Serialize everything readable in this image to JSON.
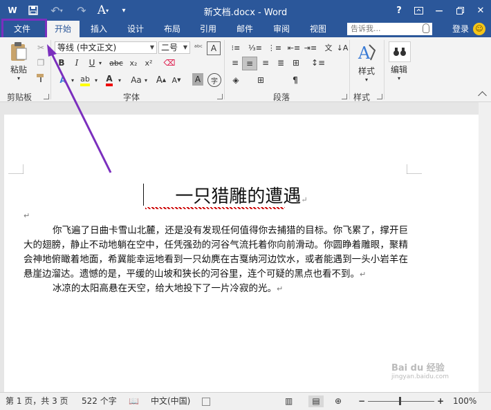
{
  "titlebar": {
    "title": "新文档.docx - Word",
    "help": "?",
    "ribbon_display": "⧉",
    "minimize": "—",
    "restore": "❐",
    "close": "✕"
  },
  "quick_access": {
    "word_icon": "W",
    "save": "💾",
    "undo": "↶",
    "redo": "↷",
    "format": "A",
    "customize": "▾"
  },
  "tabs": [
    "文件",
    "开始",
    "插入",
    "设计",
    "布局",
    "引用",
    "邮件",
    "审阅",
    "视图"
  ],
  "active_tab": "开始",
  "tell_me": {
    "placeholder": "告诉我..."
  },
  "signin": "登录",
  "ribbon": {
    "clipboard": {
      "paste": "粘贴",
      "label": "剪贴板"
    },
    "font": {
      "font_name": "等线 (中文正文)",
      "font_size": "二号",
      "label": "字体",
      "bold": "B",
      "italic": "I",
      "underline": "U",
      "strike": "abc",
      "subscript": "x₂",
      "superscript": "x²",
      "grow": "A",
      "shrink": "A",
      "char_shading": "A",
      "phonetic": "文",
      "encircle": "字",
      "aa": "Aa",
      "clear": "A",
      "font_color": "A",
      "highlight": "ab"
    },
    "paragraph": {
      "label": "段落"
    },
    "styles": {
      "button": "样式",
      "label": "样式"
    },
    "editing": {
      "button": "编辑"
    }
  },
  "document": {
    "title": "一只猎雕的遭遇",
    "paragraph_mark": "↵",
    "paragraphs": [
      "你飞遍了日曲卡雪山北麓，还是没有发现任何值得你去捕猎的目标。你飞累了，撑开巨大的翅膀，静止不动地躺在空中，任凭强劲的河谷气流托着你向前滑动。你圆睁着雕眼，聚精会神地俯瞰着地面，希冀能幸运地看到一只幼麂在古戛纳河边饮水，或者能遇到一头小岩羊在悬崖边溜达。遗憾的是，平缓的山坡和狭长的河谷里，连个可疑的黑点也看不到。",
      "冰凉的太阳高悬在天空，给大地投下了一片冷寂的光。"
    ]
  },
  "statusbar": {
    "page": "第 1 页，共 3 页",
    "words": "522 个字",
    "language": "中文(中国)",
    "zoom": "100%",
    "zoom_minus": "−",
    "zoom_plus": "+"
  },
  "watermark": {
    "brand": "Bai du 经验",
    "url": "jingyan.baidu.com"
  },
  "colors": {
    "accent": "#2b579a",
    "annotation": "#7b2fbe"
  }
}
